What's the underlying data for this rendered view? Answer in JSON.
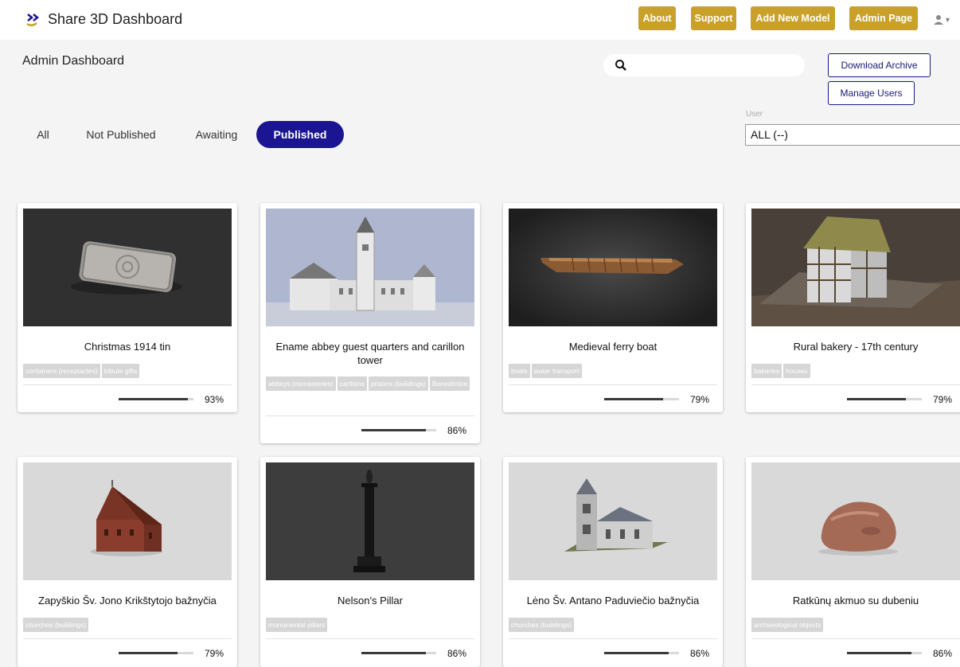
{
  "header": {
    "app_title": "Share 3D Dashboard",
    "nav": [
      "About",
      "Support",
      "Add New Model",
      "Admin Page"
    ],
    "user_icon": "user-icon",
    "user_caret": "▾"
  },
  "admin": {
    "title": "Admin Dashboard",
    "search_placeholder": "",
    "download_archive": "Download Archive",
    "manage_users": "Manage Users",
    "tabs": [
      "All",
      "Not Published",
      "Awaiting",
      "Published"
    ],
    "active_tab": "Published",
    "user_filter_label": "User",
    "user_filter_value": "ALL (--)"
  },
  "colors": {
    "accent": "#c9a02a",
    "primary": "#1b1592"
  },
  "cards": [
    {
      "title": "Christmas 1914 tin",
      "tags": [
        "containers (receptacles)",
        "tribute gifts"
      ],
      "progress": 93,
      "progress_label": "93%"
    },
    {
      "title": "Ename abbey guest quarters and carillon tower",
      "tags": [
        "abbeys (monasteries)",
        "carillons",
        "prisons (buildings)",
        "Benedictine"
      ],
      "progress": 86,
      "progress_label": "86%"
    },
    {
      "title": "Medieval ferry boat",
      "tags": [
        "boats",
        "water transport"
      ],
      "progress": 79,
      "progress_label": "79%"
    },
    {
      "title": "Rural bakery - 17th century",
      "tags": [
        "bakeries",
        "houses"
      ],
      "progress": 79,
      "progress_label": "79%"
    },
    {
      "title": "Zapyškio Šv. Jono Krikštytojo bažnyčia",
      "tags": [
        "churches (buildings)"
      ],
      "progress": 79,
      "progress_label": "79%"
    },
    {
      "title": "Nelson's Pillar",
      "tags": [
        "monumental pillars"
      ],
      "progress": 86,
      "progress_label": "86%"
    },
    {
      "title": "Lėno Šv. Antano Paduviečio bažnyčia",
      "tags": [
        "churches (buildings)"
      ],
      "progress": 86,
      "progress_label": "86%"
    },
    {
      "title": "Ratkūnų akmuo su dubeniu",
      "tags": [
        "archaeological objects"
      ],
      "progress": 86,
      "progress_label": "86%"
    }
  ]
}
